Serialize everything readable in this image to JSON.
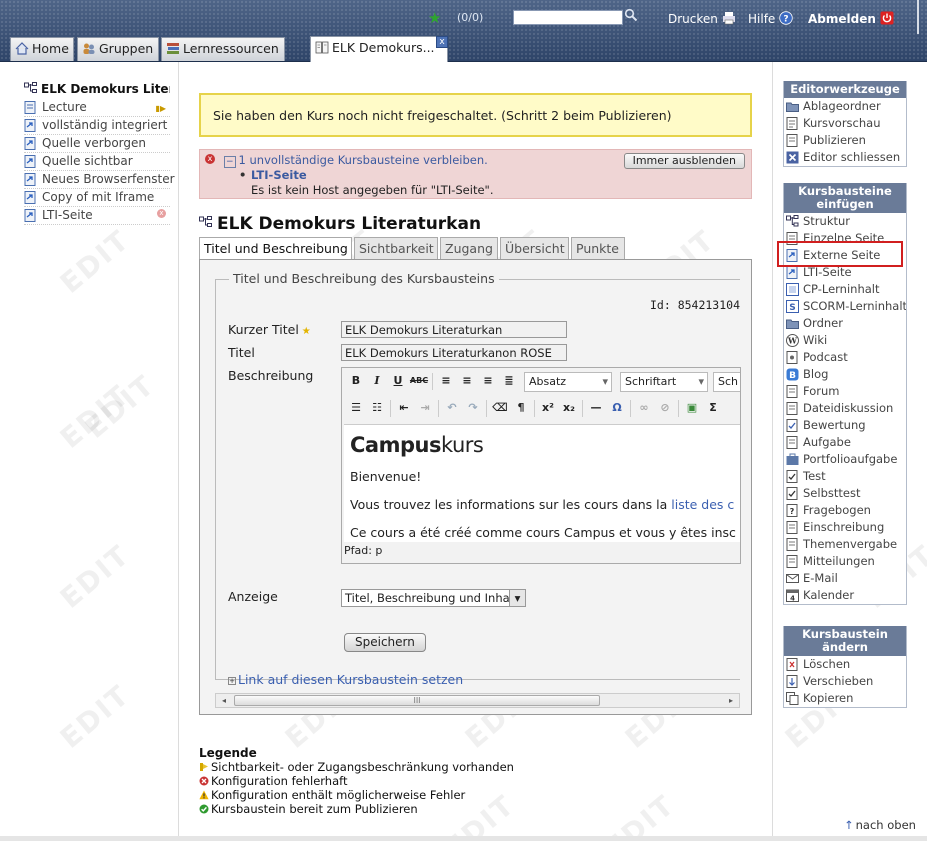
{
  "header": {
    "counter": "(0/0)",
    "search_value": "",
    "links": {
      "print": "Drucken",
      "help": "Hilfe",
      "logout": "Abmelden"
    }
  },
  "tabs": [
    {
      "label": "Home",
      "icon": "home-icon"
    },
    {
      "label": "Gruppen",
      "icon": "group-icon"
    },
    {
      "label": "Lernressourcen",
      "icon": "books-icon"
    },
    {
      "label": "ELK Demokurs...",
      "icon": "course-icon",
      "close": "x"
    }
  ],
  "left_nav": {
    "root": "ELK Demokurs Literaturkan",
    "items": [
      {
        "label": "Lecture",
        "icon": "page-icon",
        "flag": "access-restriction"
      },
      {
        "label": "vollständig integriert",
        "icon": "page-icon"
      },
      {
        "label": "Quelle verborgen",
        "icon": "page-icon"
      },
      {
        "label": "Quelle sichtbar",
        "icon": "page-icon"
      },
      {
        "label": "Neues Browserfenster",
        "icon": "page-icon"
      },
      {
        "label": "Copy of mit Iframe",
        "icon": "page-icon"
      },
      {
        "label": "LTI-Seite",
        "icon": "lti-icon",
        "flag": "error"
      }
    ]
  },
  "notice": "Sie haben den Kurs noch nicht freigeschaltet. (Schritt 2 beim Publizieren)",
  "error_box": {
    "message": "1 unvollständige Kursbausteine verbleiben.",
    "link": "LTI-Seite",
    "detail": "Es ist kein Host angegeben für \"LTI-Seite\".",
    "hide_button": "Immer ausblenden"
  },
  "course_title": "ELK Demokurs Literaturkan",
  "config_tabs": [
    "Titel und Beschreibung",
    "Sichtbarkeit",
    "Zugang",
    "Übersicht",
    "Punkte"
  ],
  "form": {
    "legend": "Titel und Beschreibung des Kursbausteins",
    "id_text": "Id: 854213104",
    "short_title_label": "Kurzer Titel",
    "short_title_value": "ELK Demokurs Literaturkan",
    "title_label": "Titel",
    "title_value": "ELK Demokurs Literaturkanon ROSE",
    "description_label": "Beschreibung",
    "editor": {
      "format_select": "Absatz",
      "font_select": "Schriftart",
      "size_select": "Sch",
      "content": {
        "logo_left": "Campus",
        "logo_right": "kurs",
        "p1": "Bienvenue!",
        "p2_text": "Vous trouvez les informations sur les cours dans la",
        "p2_link": "liste des c",
        "p3": "Ce cours a été créé comme cours Campus et vous y êtes insc"
      },
      "path": "Pfad: p"
    },
    "display_label": "Anzeige",
    "display_value": "Titel, Beschreibung und Inhalt",
    "save_button": "Speichern",
    "link_kb": "Link auf diesen Kursbaustein setzen",
    "scroll_glyph": "III"
  },
  "legend": {
    "title": "Legende",
    "items": [
      {
        "text": "Sichtbarkeit- oder Zugangsbeschränkung vorhanden",
        "icon": "restriction-icon"
      },
      {
        "text": "Konfiguration fehlerhaft",
        "icon": "error-icon"
      },
      {
        "text": "Konfiguration enthält möglicherweise Fehler",
        "icon": "warning-icon"
      },
      {
        "text": "Kursbaustein bereit zum Publizieren",
        "icon": "ok-icon"
      }
    ]
  },
  "right": {
    "editor_tools": {
      "header": "Editorwerkzeuge",
      "items": [
        "Ablageordner",
        "Kursvorschau",
        "Publizieren",
        "Editor schliessen"
      ]
    },
    "insert": {
      "header": "Kursbausteine einfügen",
      "items": [
        "Struktur",
        "Einzelne Seite",
        "Externe Seite",
        "LTI-Seite",
        "CP-Lerninhalt",
        "SCORM-Lerninhalt",
        "Ordner",
        "Wiki",
        "Podcast",
        "Blog",
        "Forum",
        "Dateidiskussion",
        "Bewertung",
        "Aufgabe",
        "Portfolioaufgabe",
        "Test",
        "Selbsttest",
        "Fragebogen",
        "Einschreibung",
        "Themenvergabe",
        "Mitteilungen",
        "E-Mail",
        "Kalender"
      ]
    },
    "change": {
      "header": "Kursbaustein ändern",
      "items": [
        "Löschen",
        "Verschieben",
        "Kopieren"
      ]
    }
  },
  "watermark": "EDIT",
  "back_to_top": "nach oben",
  "colors": {
    "accent": "#3a5fb0",
    "header": "#3a5075",
    "highlight": "#d11f1f",
    "notice_bg": "#fffbc8",
    "error_bg": "#efd5d5"
  }
}
